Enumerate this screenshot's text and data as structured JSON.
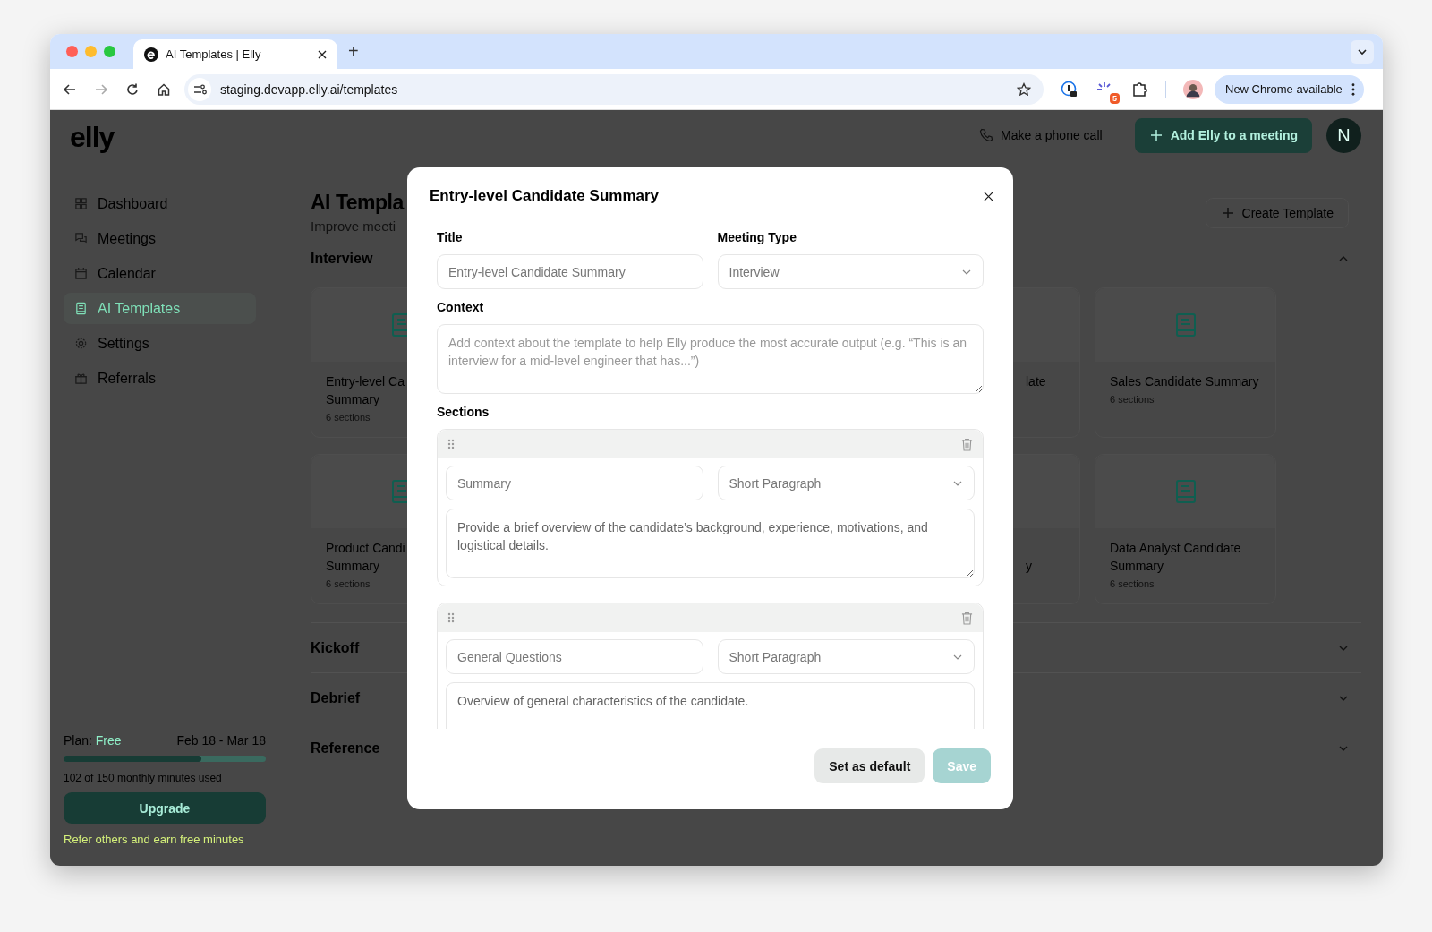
{
  "browser": {
    "tab": {
      "title": "AI Templates | Elly",
      "selected": true
    },
    "new_tab": "+",
    "url": "staging.devapp.elly.ai/templates",
    "extension_badge": "5",
    "update_button": "New Chrome available"
  },
  "app": {
    "logo": "elly",
    "phone_button": "Make a phone call",
    "add_button": "Add Elly to a meeting",
    "avatar": "N"
  },
  "sidebar": {
    "items": [
      {
        "label": "Dashboard",
        "kind": "grid",
        "selected": false
      },
      {
        "label": "Meetings",
        "kind": "chat",
        "selected": false
      },
      {
        "label": "Calendar",
        "kind": "calendar",
        "selected": false
      },
      {
        "label": "AI Templates",
        "kind": "doc",
        "selected": true
      },
      {
        "label": "Settings",
        "kind": "gear",
        "selected": false
      },
      {
        "label": "Referrals",
        "kind": "gift",
        "selected": false
      }
    ],
    "plan": {
      "label": "Plan:",
      "name": "Free",
      "period": "Feb 18 - Mar 18",
      "level": 0.68,
      "usage": "102 of 150 monthly minutes used",
      "upgrade": "Upgrade",
      "referral": "Refer others and earn free minutes"
    }
  },
  "main": {
    "title": "AI Templa",
    "subtitle": "Improve meeti",
    "create_button": "Create Template",
    "groups": [
      {
        "name": "Interview",
        "expanded": true
      },
      {
        "name": "Kickoff",
        "expanded": false
      },
      {
        "name": "Debrief",
        "expanded": false
      },
      {
        "name": "Reference",
        "expanded": false
      }
    ],
    "left_cards": [
      {
        "lines": [
          "Entry-level Ca",
          "Summary"
        ],
        "count": "6 sections"
      },
      {
        "lines": [
          "Product Candi",
          "Summary"
        ],
        "count": "6 sections"
      }
    ],
    "partial_cards": [
      {
        "line_1": "late"
      },
      {
        "line_2": "y"
      }
    ],
    "right_cards": [
      {
        "title": "Sales Candidate Summary",
        "count": "6 sections"
      },
      {
        "title": "Data Analyst Candidate Summary",
        "count": "6 sections"
      }
    ]
  },
  "modal": {
    "title": "Entry-level Candidate Summary",
    "title_label": "Title",
    "title_value": "Entry-level Candidate Summary",
    "type_label": "Meeting Type",
    "type_value": "Interview",
    "context_label": "Context",
    "context_placeholder": "Add context about the template to help Elly produce the most accurate output (e.g. “This is an interview for a mid-level engineer that has...”)",
    "sections_label": "Sections",
    "sections": [
      {
        "name": "Summary",
        "format": "Short Paragraph",
        "prompt": "Provide a brief overview of the candidate’s background, experience, motivations, and logistical details."
      },
      {
        "name": "General Questions",
        "format": "Short Paragraph",
        "prompt": "Overview of general characteristics of the candidate."
      }
    ],
    "buttons": [
      {
        "label": "Set as default",
        "kind": "secondary",
        "disabled": false
      },
      {
        "label": "Save",
        "kind": "primary",
        "disabled": true
      }
    ]
  }
}
